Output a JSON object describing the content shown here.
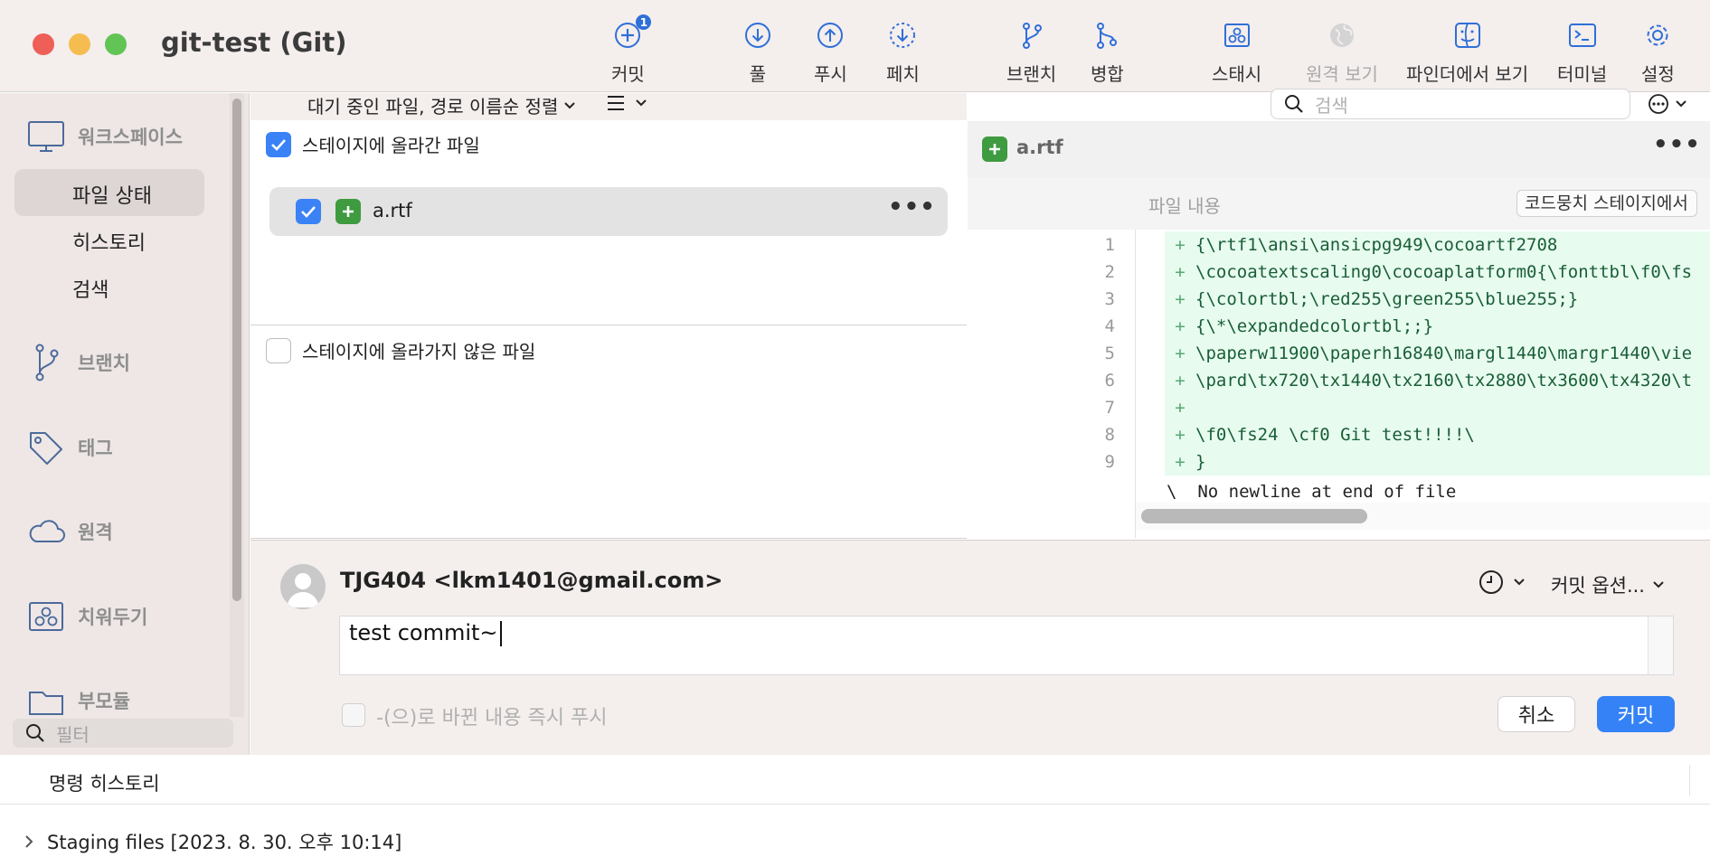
{
  "window": {
    "title": "git-test (Git)"
  },
  "toolbar": {
    "items": [
      {
        "label": "커밋",
        "icon": "commit-plus-icon",
        "badge": "1"
      },
      {
        "label": "풀",
        "icon": "pull-arrow-down-icon"
      },
      {
        "label": "푸시",
        "icon": "push-arrow-up-icon"
      },
      {
        "label": "페치",
        "icon": "fetch-dashed-arrow-icon"
      },
      {
        "label": "브랜치",
        "icon": "branch-icon"
      },
      {
        "label": "병합",
        "icon": "merge-icon"
      },
      {
        "label": "스태시",
        "icon": "stash-icon"
      },
      {
        "label": "원격 보기",
        "icon": "globe-icon",
        "disabled": true
      },
      {
        "label": "파인더에서 보기",
        "icon": "finder-icon"
      },
      {
        "label": "터미널",
        "icon": "terminal-icon"
      },
      {
        "label": "설정",
        "icon": "gear-icon"
      }
    ]
  },
  "sidebar": {
    "workspace": "워크스페이스",
    "workspace_items": [
      "파일 상태",
      "히스토리",
      "검색"
    ],
    "branches": "브랜치",
    "tags": "태그",
    "remotes": "원격",
    "stashes": "치워두기",
    "submodules": "부모듈",
    "filter_placeholder": "필터"
  },
  "files": {
    "sort_label": "대기 중인 파일, 경로 이름순 정렬",
    "staged_title": "스테이지에 올라간 파일",
    "unstaged_title": "스테이지에 올라가지 않은 파일",
    "staged_files": [
      {
        "name": "a.rtf",
        "status": "added",
        "more": "•••"
      }
    ]
  },
  "search": {
    "placeholder": "검색"
  },
  "diff": {
    "file_name": "a.rtf",
    "more": "•••",
    "hunk_title": "파일 내용",
    "stage_hunk_button": "코드뭉치 스테이지에서",
    "lines": [
      {
        "num": "1",
        "text": "{\\rtf1\\ansi\\ansicpg949\\cocoartf2708"
      },
      {
        "num": "2",
        "text": "\\cocoatextscaling0\\cocoaplatform0{\\fonttbl\\f0\\fs"
      },
      {
        "num": "3",
        "text": "{\\colortbl;\\red255\\green255\\blue255;}"
      },
      {
        "num": "4",
        "text": "{\\*\\expandedcolortbl;;}"
      },
      {
        "num": "5",
        "text": "\\paperw11900\\paperh16840\\margl1440\\margr1440\\vie"
      },
      {
        "num": "6",
        "text": "\\pard\\tx720\\tx1440\\tx2160\\tx2880\\tx3600\\tx4320\\t"
      },
      {
        "num": "7",
        "text": ""
      },
      {
        "num": "8",
        "text": "\\f0\\fs24 \\cf0 Git test!!!!\\"
      },
      {
        "num": "9",
        "text": "}"
      }
    ],
    "plus_sign": "+",
    "no_newline": "\\  No newline at end of file"
  },
  "commit": {
    "author": "TJG404 <lkm1401@gmail.com>",
    "message": "test commit~",
    "options_label": "커밋 옵션...",
    "push_label": "-(으)로 바뀐 내용 즉시 푸시",
    "cancel_label": "취소",
    "commit_label": "커밋"
  },
  "history": {
    "title": "명령 히스토리",
    "entries": [
      "Staging files [2023. 8. 30. 오후 10:14]"
    ]
  },
  "colors": {
    "accent": "#3482f6",
    "added": "#3e9b40",
    "added_bg": "#e7fbef"
  }
}
